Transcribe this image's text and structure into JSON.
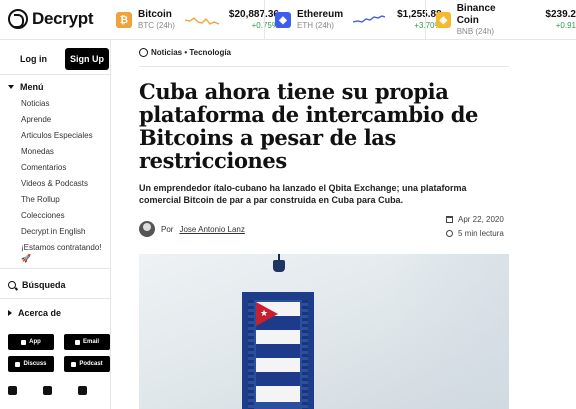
{
  "brand": {
    "name": "Decrypt"
  },
  "ticker": [
    {
      "name": "Bitcoin",
      "sub": "BTC (24h)",
      "price": "$20,887.36",
      "change": "+0.75%",
      "color": "#f0a23b",
      "symbol": "₿"
    },
    {
      "name": "Ethereum",
      "sub": "ETH (24h)",
      "price": "$1,255.88",
      "change": "+3.70%",
      "color": "#3d5cf0",
      "symbol": "◆"
    },
    {
      "name": "Binance Coin",
      "sub": "BNB (24h)",
      "price": "$239.2",
      "change": "+0.91",
      "color": "#f3ba2f",
      "symbol": "◈"
    }
  ],
  "auth": {
    "login": "Log in",
    "signup": "Sign Up"
  },
  "menu": {
    "title": "Menú",
    "items": [
      "Noticias",
      "Aprende",
      "Articulos Especiales",
      "Monedas",
      "Comentarios",
      "Videos & Podcasts",
      "The Rollup",
      "Colecciones",
      "Decrypt in English",
      "¡Estamos contratando!"
    ]
  },
  "search": {
    "label": "Búsqueda"
  },
  "about": {
    "label": "Acerca de"
  },
  "buttons": {
    "app": "App",
    "email": "Email",
    "discuss": "Discuss",
    "podcast": "Podcast"
  },
  "article": {
    "breadcrumb": "Noticias • Tecnología",
    "title": "Cuba ahora tiene su propia plataforma de intercambio de Bitcoins a pesar de las restricciones",
    "subtitle": "Un emprendedor ítalo-cubano ha lanzado el Qbita Exchange; una plataforma comercial Bitcoin de par a par construida en Cuba para Cuba.",
    "author_prefix": "Por",
    "author": "Jose Antonio Lanz",
    "date": "Apr 22, 2020",
    "read_time": "5 min lectura"
  }
}
